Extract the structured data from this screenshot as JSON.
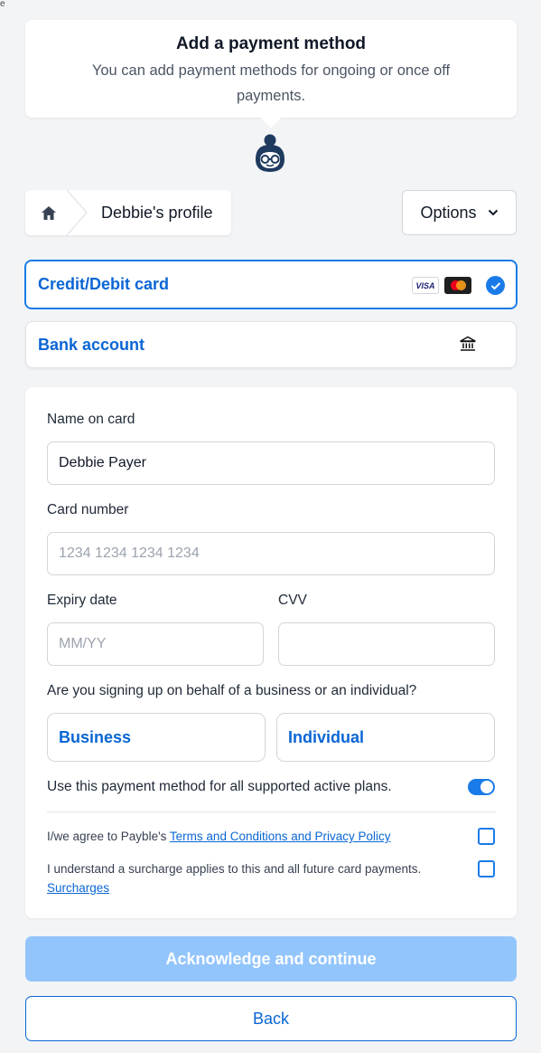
{
  "corner_mark": "e",
  "header": {
    "title": "Add a payment method",
    "subtitle": "You can add payment methods for ongoing or once off payments."
  },
  "breadcrumb": {
    "home_icon": "home-icon",
    "label": "Debbie's profile"
  },
  "options": {
    "label": "Options",
    "icon": "chevron-down-icon"
  },
  "methods": [
    {
      "label": "Credit/Debit card",
      "selected": true,
      "icons": [
        "visa-logo",
        "mastercard-logo",
        "check-circle-icon"
      ],
      "visa_text": "VISA"
    },
    {
      "label": "Bank account",
      "selected": false,
      "icons": [
        "bank-icon"
      ]
    }
  ],
  "form": {
    "name_label": "Name on card",
    "name_value": "Debbie Payer",
    "card_label": "Card number",
    "card_placeholder": "1234 1234 1234 1234",
    "expiry_label": "Expiry date",
    "expiry_placeholder": "MM/YY",
    "cvv_label": "CVV",
    "cvv_value": "",
    "entity_question": "Are you signing up on behalf of a business or an individual?",
    "entity_options": [
      "Business",
      "Individual"
    ],
    "toggle_label": "Use this payment method for all supported active plans.",
    "toggle_on": true,
    "terms_prefix": "I/we agree to Payble's ",
    "terms_link": "Terms and Conditions and Privacy Policy",
    "terms_checked": false,
    "surcharge_text": "I understand a surcharge applies to this and all future card payments.",
    "surcharge_link": "Surcharges",
    "surcharge_checked": false
  },
  "actions": {
    "continue_label": "Acknowledge and continue",
    "back_label": "Back"
  },
  "colors": {
    "accent": "#0a66d4",
    "selected_border": "#1a7be8",
    "disabled_button": "#93c5fd",
    "background": "#f3f4f6"
  }
}
